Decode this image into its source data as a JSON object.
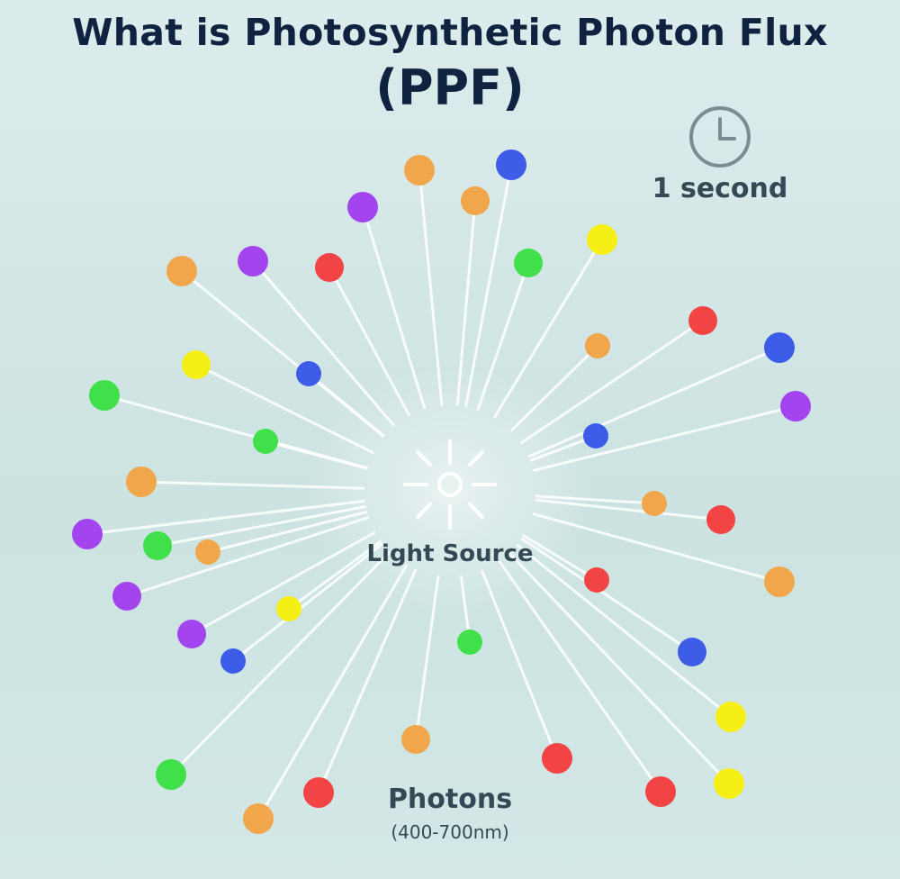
{
  "title": {
    "line1": "What is Photosynthetic Photon Flux",
    "line2": "(PPF)"
  },
  "timer": {
    "icon": "clock-icon",
    "label": "1 second"
  },
  "light_source": {
    "icon": "sun-icon",
    "label": "Light Source"
  },
  "photons": {
    "label": "Photons",
    "range": "(400-700nm)"
  },
  "colors": {
    "title": "#0f2240",
    "text": "#334a56",
    "orange": "#f2a64b",
    "purple": "#a444ee",
    "blue": "#3d5ce8",
    "green": "#3fe04a",
    "red": "#f24444",
    "yellow": "#f6ef16",
    "ray": "#ffffff"
  },
  "photon_colors": [
    "orange",
    "blue",
    "purple",
    "orange",
    "purple",
    "red",
    "yellow",
    "green",
    "orange",
    "red",
    "orange",
    "blue",
    "green",
    "blue",
    "purple",
    "yellow",
    "orange",
    "green",
    "blue",
    "orange",
    "red",
    "purple",
    "green",
    "orange",
    "purple",
    "red",
    "orange",
    "yellow",
    "purple",
    "blue",
    "green",
    "blue",
    "yellow",
    "orange",
    "red",
    "green",
    "red",
    "orange",
    "red",
    "yellow",
    "purple"
  ]
}
